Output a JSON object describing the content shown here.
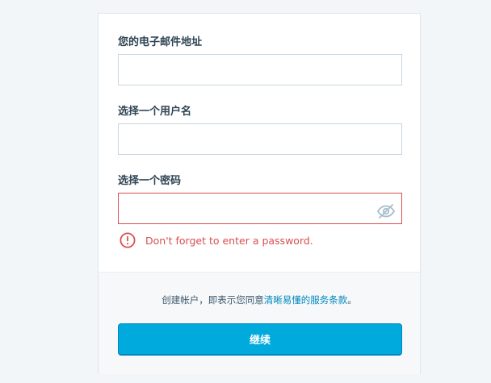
{
  "form": {
    "email_label": "您的电子邮件地址",
    "email_value": "",
    "username_label": "选择一个用户名",
    "username_value": "",
    "password_label": "选择一个密码",
    "password_value": "",
    "password_toggle_icon": "eye-slash-icon",
    "error_icon": "alert-circle-icon",
    "error_message": "Don't forget to enter a password."
  },
  "footer": {
    "tos_prefix": "创建帐户，即表示您同意",
    "tos_link": "清晰易懂的服务条款",
    "tos_suffix": "。",
    "continue_label": "继续"
  },
  "colors": {
    "accent": "#00aadc",
    "error": "#d94f4f",
    "link": "#0087be"
  }
}
